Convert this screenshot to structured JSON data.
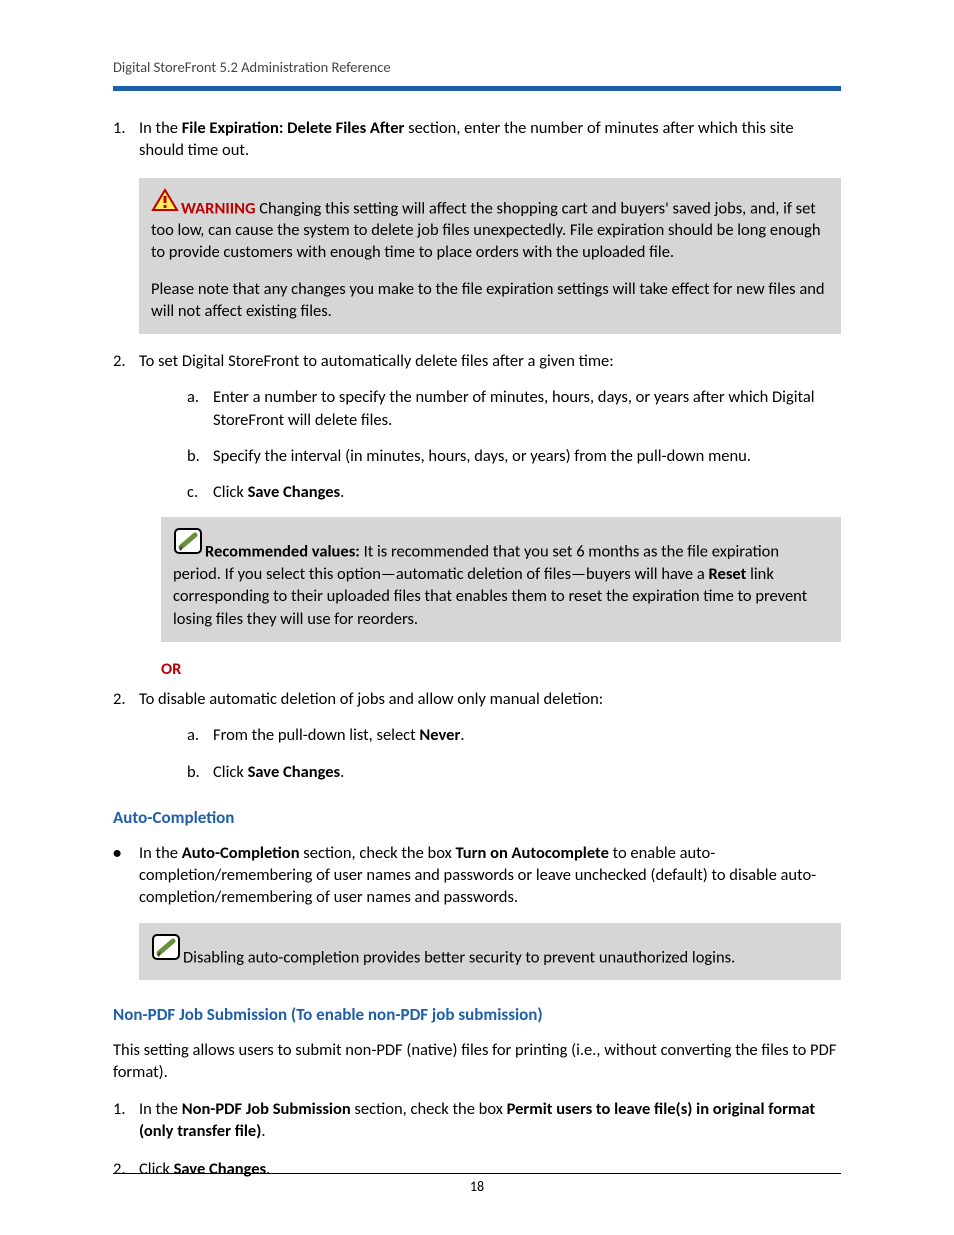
{
  "header": {
    "title": "Digital StoreFront 5.2 Administration Reference"
  },
  "steps": {
    "s1": {
      "num": "1.",
      "pre": "In the ",
      "bold": "File Expiration: Delete Files After",
      "post": " section, enter the number of minutes after which this site should time out."
    },
    "warn_box": {
      "label": "WARNIING",
      "p1": " Changing this setting will affect the shopping cart and buyers' saved jobs, and, if set too low, can cause the system to delete job files unexpectedly. File expiration should be long enough to provide customers with enough time to place orders with the uploaded file.",
      "p2": "Please note that any changes you make to the file expiration settings will take effect for new files and will not affect existing files."
    },
    "s2": {
      "num": "2.",
      "text": "To set Digital StoreFront to automatically delete files after a given time:",
      "a": {
        "lbl": "a.",
        "text": "Enter a number to specify the number of minutes, hours, days, or years after which Digital StoreFront will delete files."
      },
      "b": {
        "lbl": "b.",
        "text": "Specify the interval (in minutes, hours, days, or years) from the pull-down menu."
      },
      "c": {
        "lbl": "c.",
        "pre": "Click ",
        "bold": "Save Changes",
        "post": "."
      }
    },
    "rec_box": {
      "label": "Recommended values:",
      "p1a": " It is recommended that you set 6 months as the file expiration period. If you select this option—automatic deletion of files—buyers will have a ",
      "bold": "Reset",
      "p1b": " link corresponding to their uploaded files that enables them to reset the expiration time to prevent losing files they will use for reorders."
    },
    "or": "OR",
    "s2b": {
      "num": "2.",
      "text": "To disable automatic deletion of jobs and allow only manual deletion:",
      "a": {
        "lbl": "a.",
        "pre": "From the pull-down list, select ",
        "bold": "Never",
        "post": "."
      },
      "b": {
        "lbl": "b.",
        "pre": "Click ",
        "bold": "Save Changes",
        "post": "."
      }
    }
  },
  "auto": {
    "heading": "Auto-Completion",
    "bullet": {
      "pre": "In the ",
      "b1": "Auto-Completion",
      "mid": " section, check the box ",
      "b2": "Turn on Autocomplete",
      "post": " to enable auto-completion/remembering of user names and passwords or leave unchecked (default) to disable auto-completion/remembering of user names and passwords."
    },
    "note": "Disabling auto-completion provides better security to prevent unauthorized logins."
  },
  "nonpdf": {
    "heading": "Non-PDF Job Submission (To enable non-PDF job submission)",
    "intro": "This setting allows users to submit non-PDF (native) files for printing (i.e., without converting the files to PDF format).",
    "s1": {
      "num": "1.",
      "pre": "In the ",
      "b1": "Non-PDF Job Submission",
      "mid": " section, check the box ",
      "b2": "Permit users to leave file(s) in original format (only transfer file)",
      "post": "."
    },
    "s2": {
      "num": "2.",
      "pre": "Click ",
      "bold": "Save Changes",
      "post": "."
    }
  },
  "footer": {
    "page": "18"
  }
}
